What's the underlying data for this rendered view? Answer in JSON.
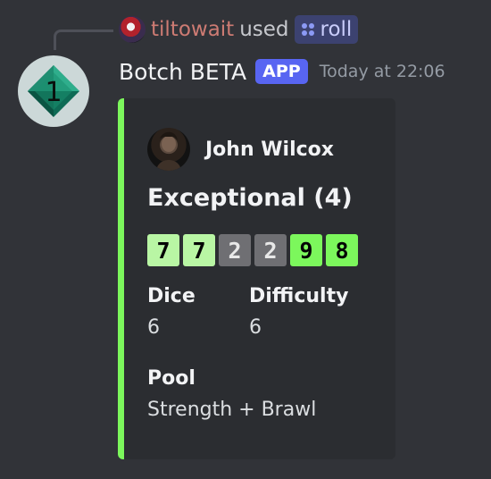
{
  "reply": {
    "user": "tiltowait",
    "action": "used",
    "command": "roll"
  },
  "message": {
    "bot_name": "Botch BETA",
    "badge": "APP",
    "timestamp": "Today at 22:06",
    "avatar_digit": "1"
  },
  "embed": {
    "accent_color": "#7cf75c",
    "author": "John Wilcox",
    "title": "Exceptional (4)",
    "dice": [
      {
        "value": "7",
        "kind": "success"
      },
      {
        "value": "7",
        "kind": "success"
      },
      {
        "value": "2",
        "kind": "fail"
      },
      {
        "value": "2",
        "kind": "fail"
      },
      {
        "value": "9",
        "kind": "crit"
      },
      {
        "value": "8",
        "kind": "crit"
      }
    ],
    "fields": {
      "dice_label": "Dice",
      "dice_value": "6",
      "difficulty_label": "Difficulty",
      "difficulty_value": "6",
      "pool_label": "Pool",
      "pool_value": "Strength + Brawl"
    }
  },
  "colors": {
    "background": "#313338",
    "embed_background": "#2b2d31",
    "username": "#cd7b73",
    "app_badge": "#5865f2",
    "success_die": "#b9f6a4",
    "fail_die": "#6f6f73",
    "crit_die": "#7cf75c"
  },
  "icons": {
    "command": "slash-command-icon",
    "bot_avatar": "diamond-number-icon"
  }
}
